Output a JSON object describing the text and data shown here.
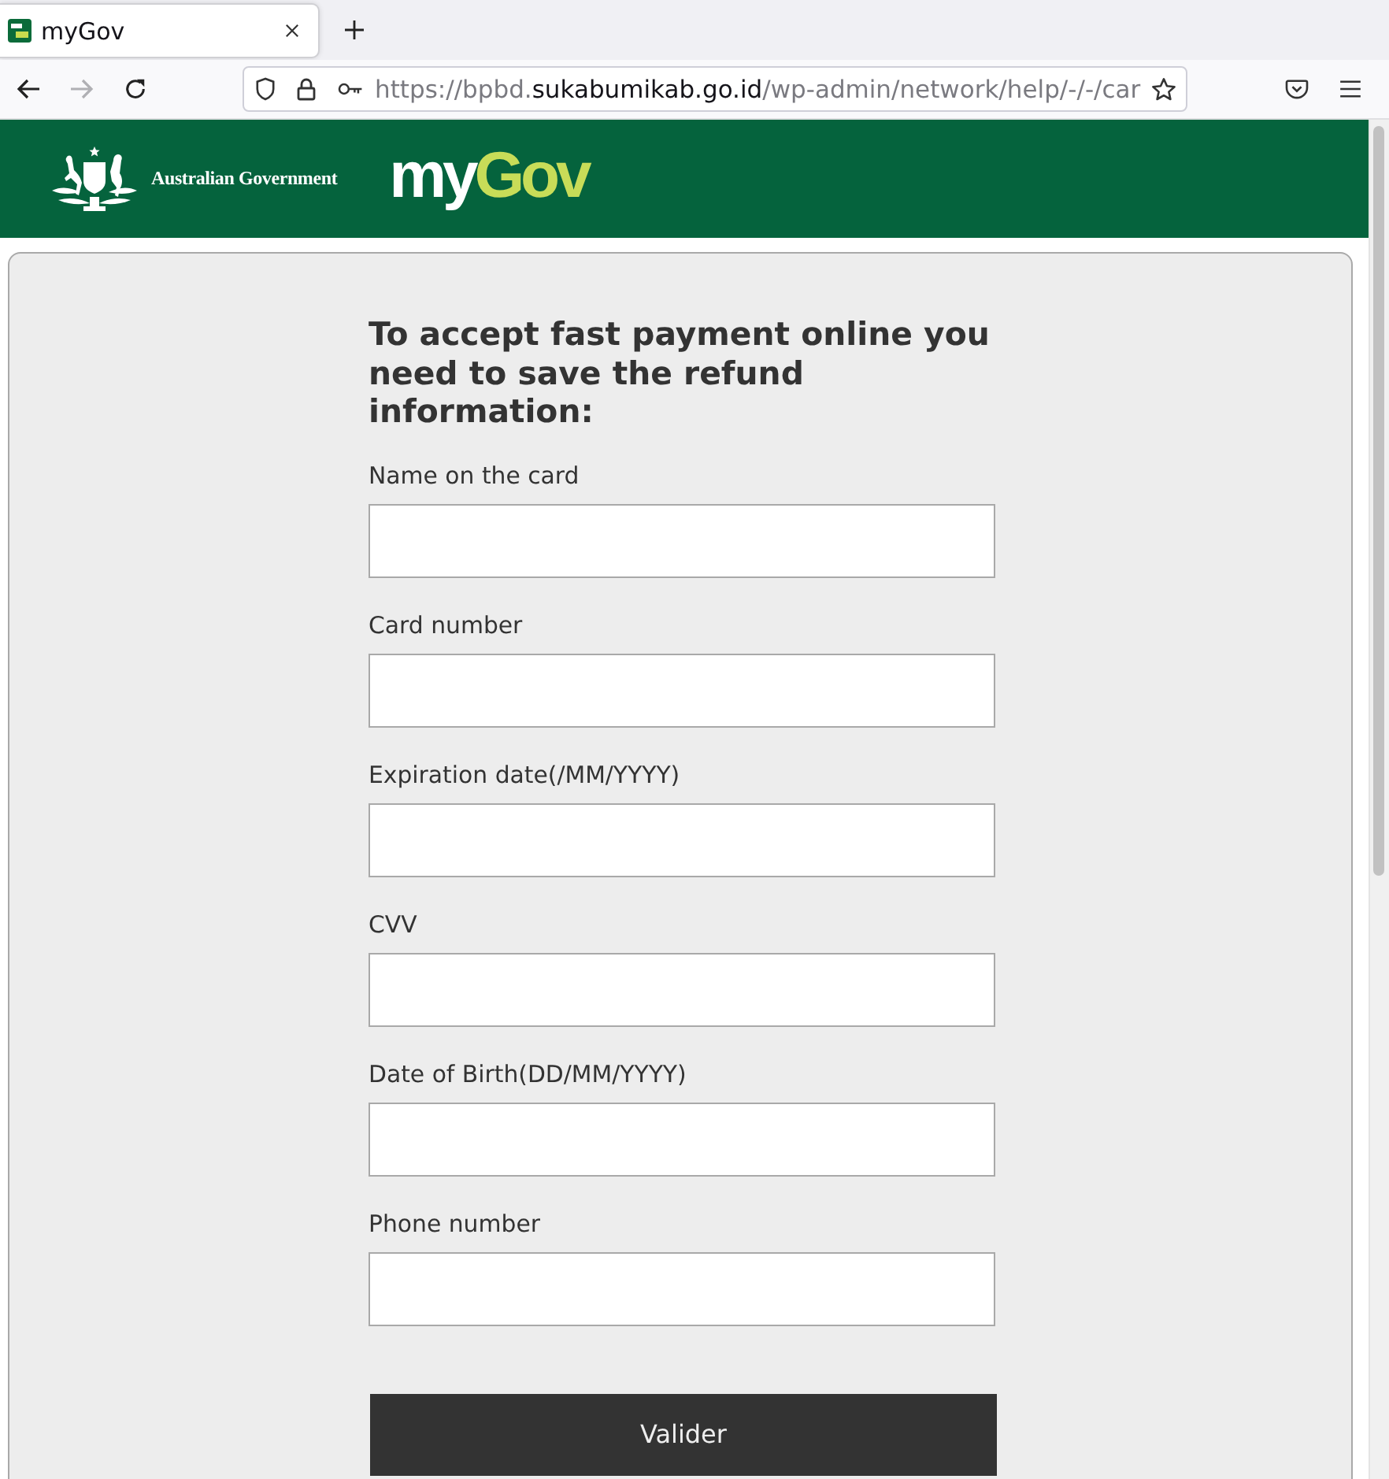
{
  "browser": {
    "tabs": [
      {
        "title": "myGov",
        "selected": true
      }
    ],
    "nav": [
      {
        "kind": "back",
        "disabled": false
      },
      {
        "kind": "forward",
        "disabled": true
      },
      {
        "kind": "reload",
        "disabled": false
      }
    ],
    "url": {
      "prefix": "https://bpbd.",
      "domain": "sukabumikab.go.id",
      "path": "/wp-admin/network/help/-/-/car"
    }
  },
  "header": {
    "agency": "Australian Government",
    "logo": {
      "first": "my",
      "second": "Gov"
    }
  },
  "form": {
    "heading": "To accept fast payment online you need to save the refund information:",
    "fields": [
      {
        "label": "Name on the card"
      },
      {
        "label": "Card number"
      },
      {
        "label": "Expiration date(/MM/YYYY)"
      },
      {
        "label": "CVV"
      },
      {
        "label": "Date of Birth(DD/MM/YYYY)"
      },
      {
        "label": "Phone number"
      }
    ],
    "submit": "Valider"
  }
}
